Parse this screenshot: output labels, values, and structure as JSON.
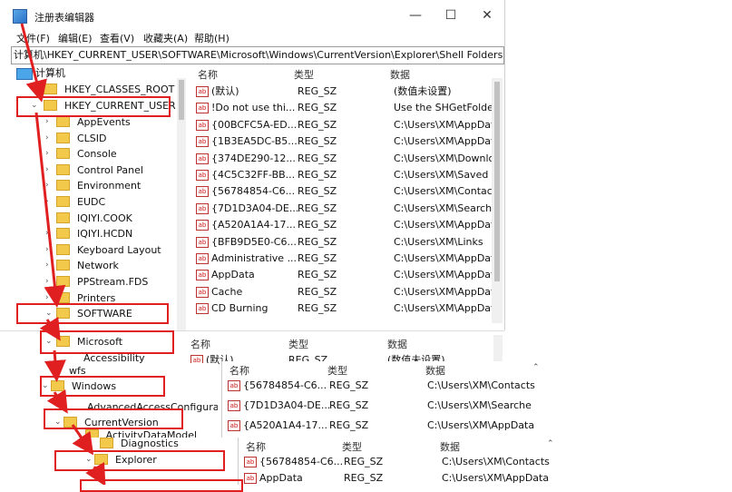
{
  "window": {
    "title": "注册表编辑器",
    "minimize": "—",
    "maximize": "☐",
    "close": "✕"
  },
  "menu": [
    "文件(F)",
    "编辑(E)",
    "查看(V)",
    "收藏夹(A)",
    "帮助(H)"
  ],
  "address": "计算机\\HKEY_CURRENT_USER\\SOFTWARE\\Microsoft\\Windows\\CurrentVersion\\Explorer\\Shell Folders",
  "tree": {
    "root": "计算机",
    "hkcr": "HKEY_CLASSES_ROOT",
    "hkcu": "HKEY_CURRENT_USER",
    "children": [
      "AppEvents",
      "CLSID",
      "Console",
      "Control Panel",
      "Environment",
      "EUDC",
      "IQIYI.COOK",
      "IQIYI.HCDN",
      "Keyboard Layout",
      "Network",
      "PPStream.FDS",
      "Printers",
      "SOFTWARE"
    ]
  },
  "list": {
    "headers": [
      "名称",
      "类型",
      "数据"
    ],
    "rows": [
      [
        "(默认)",
        "REG_SZ",
        "(数值未设置)"
      ],
      [
        "!Do not use thi...",
        "REG_SZ",
        "Use the SHGetFolderP"
      ],
      [
        "{00BCFC5A-ED...",
        "REG_SZ",
        "C:\\Users\\XM\\AppData"
      ],
      [
        "{1B3EA5DC-B5...",
        "REG_SZ",
        "C:\\Users\\XM\\AppData"
      ],
      [
        "{374DE290-12...",
        "REG_SZ",
        "C:\\Users\\XM\\Downloa"
      ],
      [
        "{4C5C32FF-BB...",
        "REG_SZ",
        "C:\\Users\\XM\\Saved G"
      ],
      [
        "{56784854-C6...",
        "REG_SZ",
        "C:\\Users\\XM\\Contacts"
      ],
      [
        "{7D1D3A04-DE...",
        "REG_SZ",
        "C:\\Users\\XM\\Searche"
      ],
      [
        "{A520A1A4-17...",
        "REG_SZ",
        "C:\\Users\\XM\\AppData"
      ],
      [
        "{BFB9D5E0-C6...",
        "REG_SZ",
        "C:\\Users\\XM\\Links"
      ],
      [
        "Administrative ...",
        "REG_SZ",
        "C:\\Users\\XM\\AppData"
      ],
      [
        "AppData",
        "REG_SZ",
        "C:\\Users\\XM\\AppData"
      ],
      [
        "Cache",
        "REG_SZ",
        "C:\\Users\\XM\\AppData"
      ],
      [
        "CD Burning",
        "REG_SZ",
        "C:\\Users\\XM\\AppData"
      ]
    ]
  },
  "crop1": {
    "tree": [
      "Microsoft",
      "Accessibility",
      "wfs",
      "Windows"
    ],
    "headers": [
      "名称",
      "类型",
      "数据"
    ],
    "row": [
      "(默认)",
      "REG_SZ",
      "(数值未设置)"
    ]
  },
  "crop2": {
    "tree": [
      "CurrentVersion",
      "ActivityDataModel",
      "AdvancedAccessConfigura",
      "Diagnostics"
    ],
    "headers": [
      "名称",
      "类型",
      "数据"
    ],
    "rows": [
      [
        "{56784854-C6...",
        "REG_SZ",
        "C:\\Users\\XM\\Contacts"
      ],
      [
        "{7D1D3A04-DE...",
        "REG_SZ",
        "C:\\Users\\XM\\Searche"
      ],
      [
        "{A520A1A4-17...",
        "REG_SZ",
        "C:\\Users\\XM\\AppData"
      ]
    ]
  },
  "crop3": {
    "tree": [
      "Explorer"
    ],
    "headers": [
      "名称",
      "类型",
      "数据"
    ],
    "rows": [
      [
        "{56784854-C6...",
        "REG_SZ",
        "C:\\Users\\XM\\Contacts"
      ],
      [
        "AppData",
        "REG_SZ",
        "C:\\Users\\XM\\AppData"
      ]
    ]
  },
  "colors": {
    "highlight": "#e02020",
    "folder": "#f3c94b"
  }
}
